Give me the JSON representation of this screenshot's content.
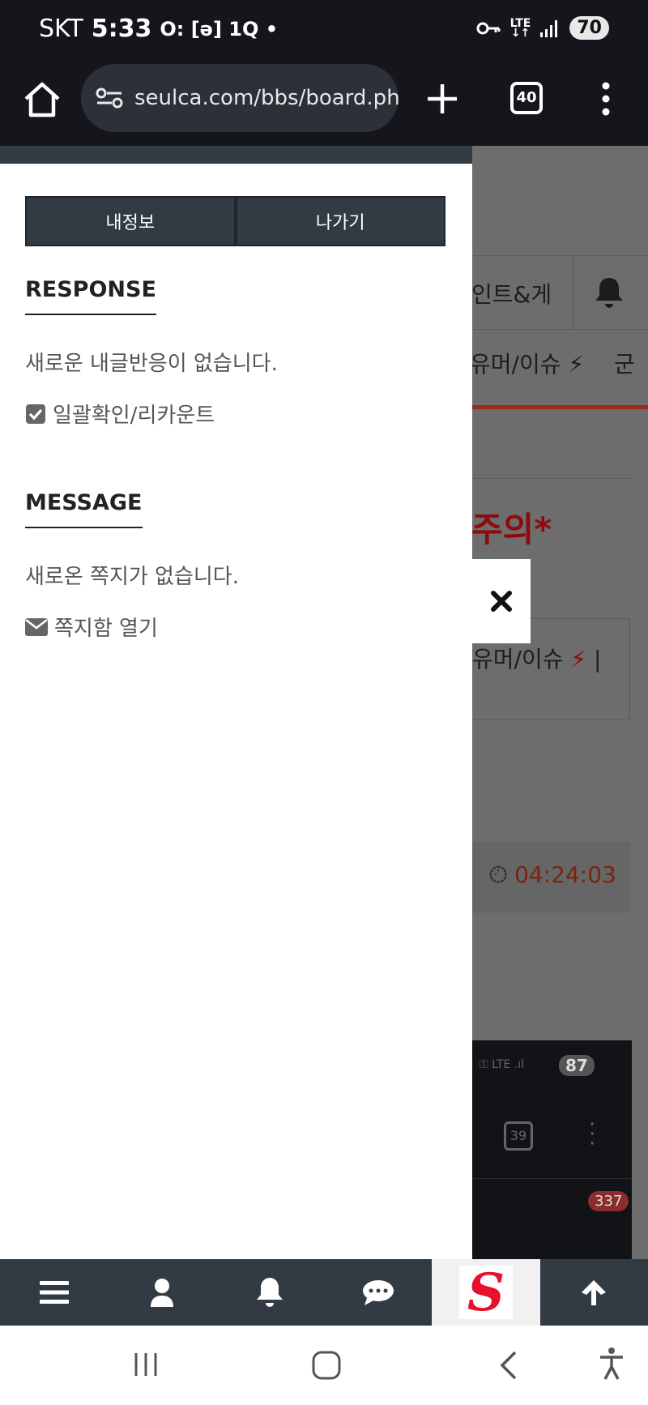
{
  "status_bar": {
    "carrier": "SKT",
    "time": "5:33",
    "indicator_icons": "O: [ə] 1Q •",
    "network": "LTE",
    "battery": "70"
  },
  "browser": {
    "url": "seulca.com/bbs/board.ph",
    "tab_count": "40"
  },
  "drawer": {
    "buttons": {
      "my_info": "내정보",
      "logout": "나가기"
    },
    "response": {
      "title": "RESPONSE",
      "empty_text": "새로운 내글반응이 없습니다.",
      "action_label": "일괄확인/리카운트"
    },
    "message": {
      "title": "MESSAGE",
      "empty_text": "새로온 쪽지가 없습니다.",
      "action_label": "쪽지함 열기"
    }
  },
  "background_page": {
    "nav_text": "인트&게",
    "category_text": "유머/이슈",
    "category_text_2": "군",
    "warning_text": "주의*",
    "box_text": "유머/이슈",
    "box_sep": "|",
    "timer": "04:24:03",
    "embedded_screenshot": {
      "battery": "87",
      "tab_count": "39",
      "notif_count": "337"
    }
  },
  "bottom_nav": {
    "logo_letter": "S"
  },
  "colors": {
    "dark": "#14161c",
    "panel": "#323a44",
    "accent_red": "#e8102a"
  }
}
